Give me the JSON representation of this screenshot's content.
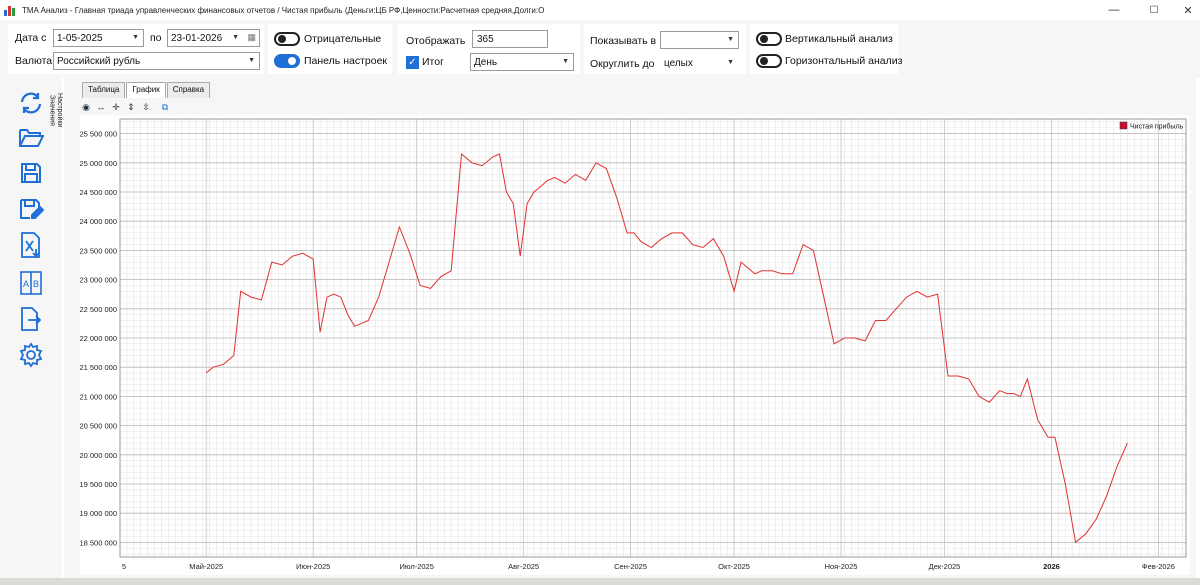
{
  "window": {
    "title": "TMA Анализ - Главная триада управленческих финансовых отчетов / Чистая прибыль (Деньги:ЦБ РФ,Ценности:Расчетная средняя,Долги:О",
    "minimize": "—",
    "maximize": "☐",
    "close": "✕"
  },
  "filters": {
    "date_from_label": "Дата с",
    "date_from": "1-05-2025",
    "date_to_label": "по",
    "date_to": "23-01-2026",
    "currency_label": "Валюта",
    "currency": "Российский рубль",
    "negatives_label": "Отрицательные",
    "negatives_on": false,
    "settings_panel_label": "Панель настроек",
    "settings_panel_on": true,
    "display_label": "Отображать",
    "display_value": "365",
    "total_label": "Итог",
    "total_checked": true,
    "period_value": "День",
    "show_in_label": "Показывать в",
    "show_in_value": "",
    "round_to_label": "Округлить до",
    "round_to_value": "целых",
    "vertical_label": "Вертикальный анализ",
    "vertical_on": false,
    "horizontal_label": "Горизонтальный анализ",
    "horizontal_on": false
  },
  "sidebar": {
    "tab_label": "Настройки Значения",
    "tools": [
      "refresh-icon",
      "open-folder-icon",
      "save-icon",
      "save-as-icon",
      "excel-export-icon",
      "ab-compare-icon",
      "export-icon",
      "gear-icon"
    ]
  },
  "tabs": [
    {
      "label": "Таблица",
      "active": false
    },
    {
      "label": "График",
      "active": true
    },
    {
      "label": "Справка",
      "active": false
    }
  ],
  "colors": {
    "accent": "#1e6fd6",
    "series": "#e03030",
    "legend_swatch": "#c8102e"
  },
  "chart_data": {
    "type": "line",
    "legend": "Чистая прибыль",
    "x_tick_labels": [
      "5",
      "Май-2025",
      "Июн-2025",
      "Июл-2025",
      "Авг-2025",
      "Сен-2025",
      "Окт-2025",
      "Ноя-2025",
      "Дек-2025",
      "2026",
      "Фев-2026"
    ],
    "y_tick_labels": [
      "25 500 000",
      "25 000 000",
      "24 500 000",
      "24 000 000",
      "23 500 000",
      "23 000 000",
      "22 500 000",
      "22 000 000",
      "21 500 000",
      "21 000 000",
      "20 500 000",
      "20 000 000",
      "19 500 000",
      "19 000 000",
      "18 500 000"
    ],
    "ylim": [
      18250000,
      25750000
    ],
    "grid": true,
    "legend_position": "top-right",
    "x_axis": {
      "start": "2025-04-06",
      "end": "2026-02-09"
    },
    "x": [
      "2025-05-01",
      "2025-05-03",
      "2025-05-06",
      "2025-05-09",
      "2025-05-11",
      "2025-05-14",
      "2025-05-17",
      "2025-05-20",
      "2025-05-23",
      "2025-05-26",
      "2025-05-29",
      "2025-06-01",
      "2025-06-03",
      "2025-06-05",
      "2025-06-07",
      "2025-06-09",
      "2025-06-11",
      "2025-06-13",
      "2025-06-15",
      "2025-06-17",
      "2025-06-20",
      "2025-06-23",
      "2025-06-26",
      "2025-06-29",
      "2025-07-02",
      "2025-07-05",
      "2025-07-08",
      "2025-07-11",
      "2025-07-14",
      "2025-07-17",
      "2025-07-20",
      "2025-07-23",
      "2025-07-25",
      "2025-07-27",
      "2025-07-29",
      "2025-07-31",
      "2025-08-02",
      "2025-08-04",
      "2025-08-06",
      "2025-08-08",
      "2025-08-10",
      "2025-08-13",
      "2025-08-16",
      "2025-08-19",
      "2025-08-22",
      "2025-08-25",
      "2025-08-28",
      "2025-08-31",
      "2025-09-02",
      "2025-09-04",
      "2025-09-07",
      "2025-09-10",
      "2025-09-13",
      "2025-09-16",
      "2025-09-19",
      "2025-09-22",
      "2025-09-25",
      "2025-09-28",
      "2025-10-01",
      "2025-10-03",
      "2025-10-05",
      "2025-10-07",
      "2025-10-09",
      "2025-10-12",
      "2025-10-15",
      "2025-10-18",
      "2025-10-21",
      "2025-10-24",
      "2025-10-27",
      "2025-10-30",
      "2025-11-02",
      "2025-11-05",
      "2025-11-08",
      "2025-11-11",
      "2025-11-14",
      "2025-11-17",
      "2025-11-20",
      "2025-11-23",
      "2025-11-26",
      "2025-11-29",
      "2025-12-02",
      "2025-12-05",
      "2025-12-08",
      "2025-12-11",
      "2025-12-14",
      "2025-12-17",
      "2025-12-19",
      "2025-12-21",
      "2025-12-23",
      "2025-12-25",
      "2025-12-28",
      "2025-12-31",
      "2026-01-02",
      "2026-01-05",
      "2026-01-08",
      "2026-01-11",
      "2026-01-14",
      "2026-01-17",
      "2026-01-20",
      "2026-01-23"
    ],
    "values": [
      21400000,
      21500000,
      21550000,
      21700000,
      22800000,
      22700000,
      22650000,
      23300000,
      23250000,
      23400000,
      23450000,
      23350000,
      22100000,
      22700000,
      22750000,
      22700000,
      22400000,
      22200000,
      22250000,
      22300000,
      22700000,
      23300000,
      23900000,
      23450000,
      22900000,
      22850000,
      23050000,
      23150000,
      25150000,
      25000000,
      24950000,
      25100000,
      25150000,
      24500000,
      24300000,
      23400000,
      24300000,
      24500000,
      24600000,
      24700000,
      24750000,
      24650000,
      24800000,
      24700000,
      25000000,
      24900000,
      24400000,
      23800000,
      23800000,
      23650000,
      23550000,
      23700000,
      23800000,
      23800000,
      23600000,
      23550000,
      23700000,
      23400000,
      22800000,
      23300000,
      23200000,
      23100000,
      23150000,
      23150000,
      23100000,
      23100000,
      23600000,
      23500000,
      22700000,
      21900000,
      22000000,
      22000000,
      21950000,
      22300000,
      22300000,
      22500000,
      22700000,
      22800000,
      22700000,
      22750000,
      21350000,
      21350000,
      21300000,
      21000000,
      20900000,
      21100000,
      21050000,
      21050000,
      21000000,
      21300000,
      20600000,
      20300000,
      20300000,
      19500000,
      18500000,
      18650000,
      18900000,
      19300000,
      19800000,
      20200000
    ]
  }
}
